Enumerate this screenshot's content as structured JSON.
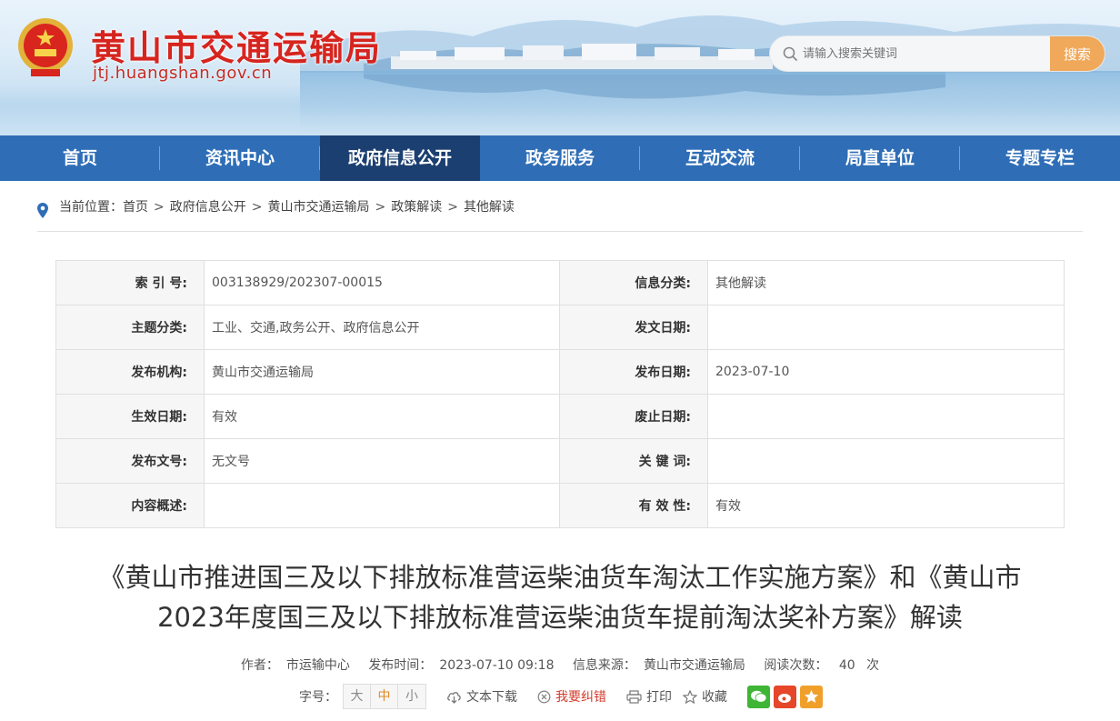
{
  "header": {
    "site_title": "黄山市交通运输局",
    "site_domain": "jtj.huangshan.gov.cn",
    "search_placeholder": "请输入搜索关键词",
    "search_button": "搜索"
  },
  "nav": {
    "items": [
      {
        "label": "首页"
      },
      {
        "label": "资讯中心"
      },
      {
        "label": "政府信息公开"
      },
      {
        "label": "政务服务"
      },
      {
        "label": "互动交流"
      },
      {
        "label": "局直单位"
      },
      {
        "label": "专题专栏"
      }
    ],
    "active_index": 2
  },
  "breadcrumb": {
    "prefix": "当前位置：",
    "items": [
      "首页",
      "政府信息公开",
      "黄山市交通运输局",
      "政策解读",
      "其他解读"
    ],
    "separator": ">"
  },
  "meta": {
    "rows": [
      {
        "l1": "索 引 号:",
        "v1": "003138929/202307-00015",
        "l2": "信息分类:",
        "v2": "其他解读"
      },
      {
        "l1": "主题分类:",
        "v1": "工业、交通,政务公开、政府信息公开",
        "l2": "发文日期:",
        "v2": ""
      },
      {
        "l1": "发布机构:",
        "v1": "黄山市交通运输局",
        "l2": "发布日期:",
        "v2": "2023-07-10"
      },
      {
        "l1": "生效日期:",
        "v1": "有效",
        "l2": "废止日期:",
        "v2": ""
      },
      {
        "l1": "发布文号:",
        "v1": "无文号",
        "l2": "关 键 词:",
        "v2": ""
      },
      {
        "l1": "内容概述:",
        "v1": "",
        "l2": "有 效 性:",
        "v2": "有效"
      }
    ]
  },
  "article": {
    "title_line1": "《黄山市推进国三及以下排放标准营运柴油货车淘汰工作实施方案》和《黄山市",
    "title_line2": "2023年度国三及以下排放标准营运柴油货车提前淘汰奖补方案》解读",
    "author_label": "作者：",
    "author": "市运输中心",
    "time_label": "发布时间：",
    "time": "2023-07-10 09:18",
    "source_label": "信息来源：",
    "source": "黄山市交通运输局",
    "views_label": "阅读次数：",
    "views": "40",
    "views_unit": "次"
  },
  "tools": {
    "font_label": "字号：",
    "font_sizes": [
      "大",
      "中",
      "小"
    ],
    "download": "文本下载",
    "error": "我要纠错",
    "print": "打印",
    "favorite": "收藏"
  },
  "colors": {
    "nav_bg": "#2f6eb7",
    "nav_active": "#1b3f70",
    "title_red": "#d6241e",
    "search_btn": "#f0a85a"
  }
}
